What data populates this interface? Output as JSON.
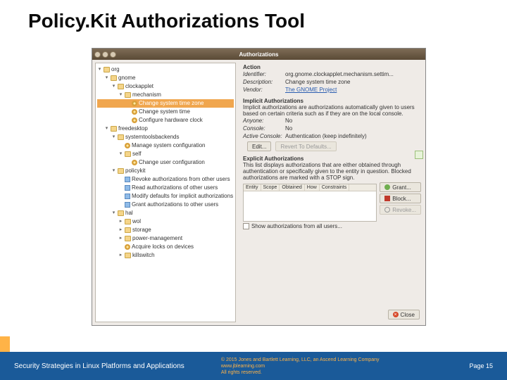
{
  "slide": {
    "title": "Policy.Kit Authorizations Tool"
  },
  "window": {
    "title": "Authorizations",
    "close_btn": "Close",
    "show_all_label": "Show authorizations from all users..."
  },
  "tree": [
    {
      "ind": 0,
      "tw": "▾",
      "ic": "fld",
      "label": "org"
    },
    {
      "ind": 1,
      "tw": "▾",
      "ic": "fld",
      "label": "gnome"
    },
    {
      "ind": 2,
      "tw": "▾",
      "ic": "fld",
      "label": "clockapplet"
    },
    {
      "ind": 3,
      "tw": "▾",
      "ic": "fld",
      "label": "mechanism"
    },
    {
      "ind": 4,
      "tw": "",
      "ic": "cog",
      "label": "Change system time zone",
      "sel": true
    },
    {
      "ind": 4,
      "tw": "",
      "ic": "cog",
      "label": "Change system time"
    },
    {
      "ind": 4,
      "tw": "",
      "ic": "cog",
      "label": "Configure hardware clock"
    },
    {
      "ind": 1,
      "tw": "▾",
      "ic": "fld",
      "label": "freedesktop"
    },
    {
      "ind": 2,
      "tw": "▾",
      "ic": "fld",
      "label": "systemtoolsbackends"
    },
    {
      "ind": 3,
      "tw": "",
      "ic": "cog",
      "label": "Manage system configuration"
    },
    {
      "ind": 3,
      "tw": "▾",
      "ic": "fld",
      "label": "self"
    },
    {
      "ind": 4,
      "tw": "",
      "ic": "cog",
      "label": "Change user configuration"
    },
    {
      "ind": 2,
      "tw": "▾",
      "ic": "fld",
      "label": "policykit"
    },
    {
      "ind": 3,
      "tw": "",
      "ic": "keyi",
      "label": "Revoke authorizations from other users"
    },
    {
      "ind": 3,
      "tw": "",
      "ic": "keyi",
      "label": "Read authorizations of other users"
    },
    {
      "ind": 3,
      "tw": "",
      "ic": "keyi",
      "label": "Modify defaults for implicit authorizations"
    },
    {
      "ind": 3,
      "tw": "",
      "ic": "keyi",
      "label": "Grant authorizations to other users"
    },
    {
      "ind": 2,
      "tw": "▾",
      "ic": "fld",
      "label": "hal"
    },
    {
      "ind": 3,
      "tw": "▸",
      "ic": "fld",
      "label": "wol"
    },
    {
      "ind": 3,
      "tw": "▸",
      "ic": "fld",
      "label": "storage"
    },
    {
      "ind": 3,
      "tw": "▸",
      "ic": "fld",
      "label": "power-management"
    },
    {
      "ind": 3,
      "tw": "",
      "ic": "cog",
      "label": "Acquire locks on devices"
    },
    {
      "ind": 3,
      "tw": "▸",
      "ic": "fld",
      "label": "killswitch"
    }
  ],
  "action": {
    "head": "Action",
    "identifier_k": "Identifier:",
    "identifier_v": "org.gnome.clockapplet.mechanism.settim...",
    "description_k": "Description:",
    "description_v": "Change system time zone",
    "vendor_k": "Vendor:",
    "vendor_v": "The GNOME Project"
  },
  "implicit": {
    "head": "Implicit Authorizations",
    "blurb": "Implicit authorizations are authorizations automatically given to users based on certain criteria such as if they are on the local console.",
    "anyone_k": "Anyone:",
    "anyone_v": "No",
    "console_k": "Console:",
    "console_v": "No",
    "active_k": "Active Console:",
    "active_v": "Authentication (keep indefinitely)",
    "edit_btn": "Edit...",
    "revert_btn": "Revert To Defaults..."
  },
  "explicit": {
    "head": "Explicit Authorizations",
    "blurb": "This list displays authorizations that are either obtained through authentication or specifically given to the entity in question. Blocked authorizations are marked with a STOP sign.",
    "cols": [
      "Entity",
      "Scope",
      "Obtained",
      "How",
      "Constraints"
    ],
    "grant_btn": "Grant...",
    "block_btn": "Block...",
    "revoke_btn": "Revoke..."
  },
  "footer": {
    "left": "Security Strategies in Linux Platforms and Applications",
    "copyright": "© 2015 Jones and Bartlett Learning, LLC, an Ascend Learning Company",
    "site": "www.jblearning.com",
    "rights": "All rights reserved.",
    "page": "Page 15"
  }
}
